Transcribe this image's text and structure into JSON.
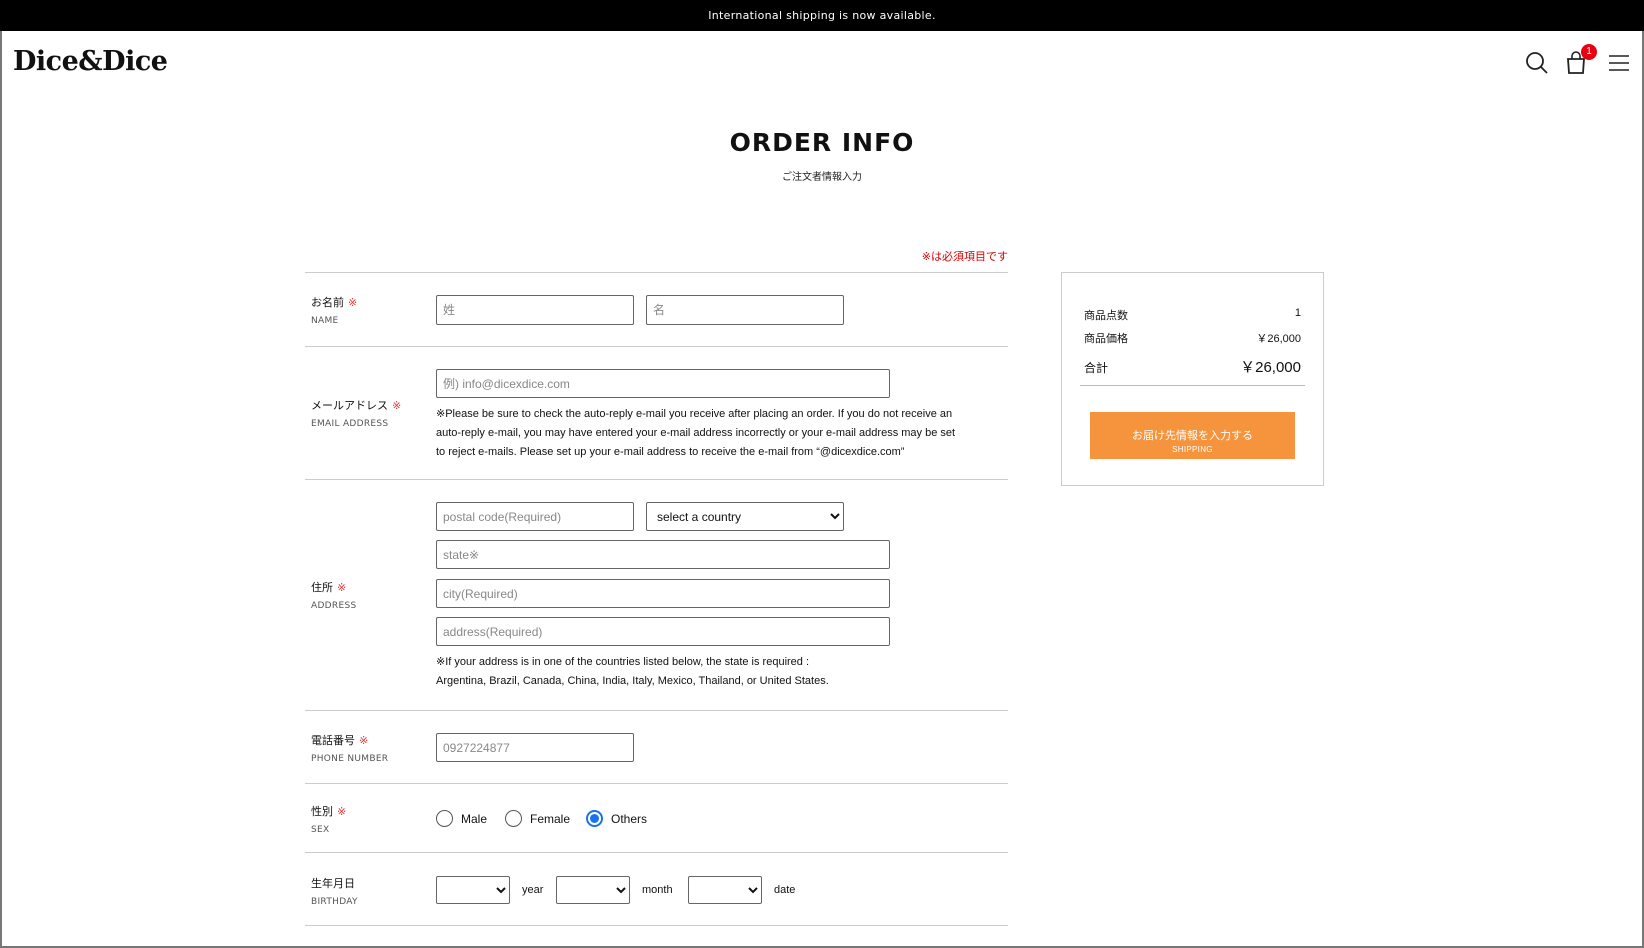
{
  "announcement": "International shipping is now available.",
  "brand": {
    "logo": "Dice&Dice"
  },
  "header": {
    "cart_count": "1"
  },
  "page": {
    "title": "ORDER INFO",
    "subtitle": "ご注文者情報入力"
  },
  "required_note": "※は必須項目です",
  "required_mark": "※",
  "form": {
    "name": {
      "label_jp": "お名前",
      "label_en": "NAME",
      "last_placeholder": "姓",
      "first_placeholder": "名"
    },
    "email": {
      "label_jp": "メールアドレス",
      "label_en": "EMAIL ADDRESS",
      "placeholder": "例) info@dicexdice.com",
      "note_lines": [
        "※Please be sure to check the auto-reply e-mail you receive after placing an order. If you do not receive an",
        "auto-reply e-mail, you may have entered your e-mail address incorrectly or your e-mail address may be set",
        "to reject e-mails. Please set up your e-mail address to receive the e-mail from “@dicexdice.com”"
      ]
    },
    "address": {
      "label_jp": "住所",
      "label_en": "ADDRESS",
      "postal_placeholder": "postal code(Required)",
      "country_selected": "select a country",
      "state_placeholder": "state※",
      "city_placeholder": "city(Required)",
      "address_placeholder": "address(Required)",
      "note_lines": [
        "※If your address is in one of the countries listed below, the state is required :",
        "Argentina, Brazil, Canada, China, India, Italy, Mexico, Thailand, or United States."
      ]
    },
    "phone": {
      "label_jp": "電話番号",
      "label_en": "PHONE NUMBER",
      "placeholder": "0927224877"
    },
    "sex": {
      "label_jp": "性別",
      "label_en": "SEX",
      "options": [
        "Male",
        "Female",
        "Others"
      ],
      "selected": "Others"
    },
    "birthday": {
      "label_jp": "生年月日",
      "label_en": "BIRTHDAY",
      "year_unit": "year",
      "month_unit": "month",
      "date_unit": "date"
    }
  },
  "summary": {
    "items_label": "商品点数",
    "items_value": "1",
    "price_label": "商品価格",
    "price_value": "￥26,000",
    "total_label": "合計",
    "total_value": "￥26,000",
    "button_main": "お届け先情報を入力する",
    "button_sub": "SHIPPING"
  },
  "colors": {
    "accent": "#f5943d",
    "required": "#e53b3b",
    "badge": "#e60012",
    "radio": "#1a73e8"
  }
}
